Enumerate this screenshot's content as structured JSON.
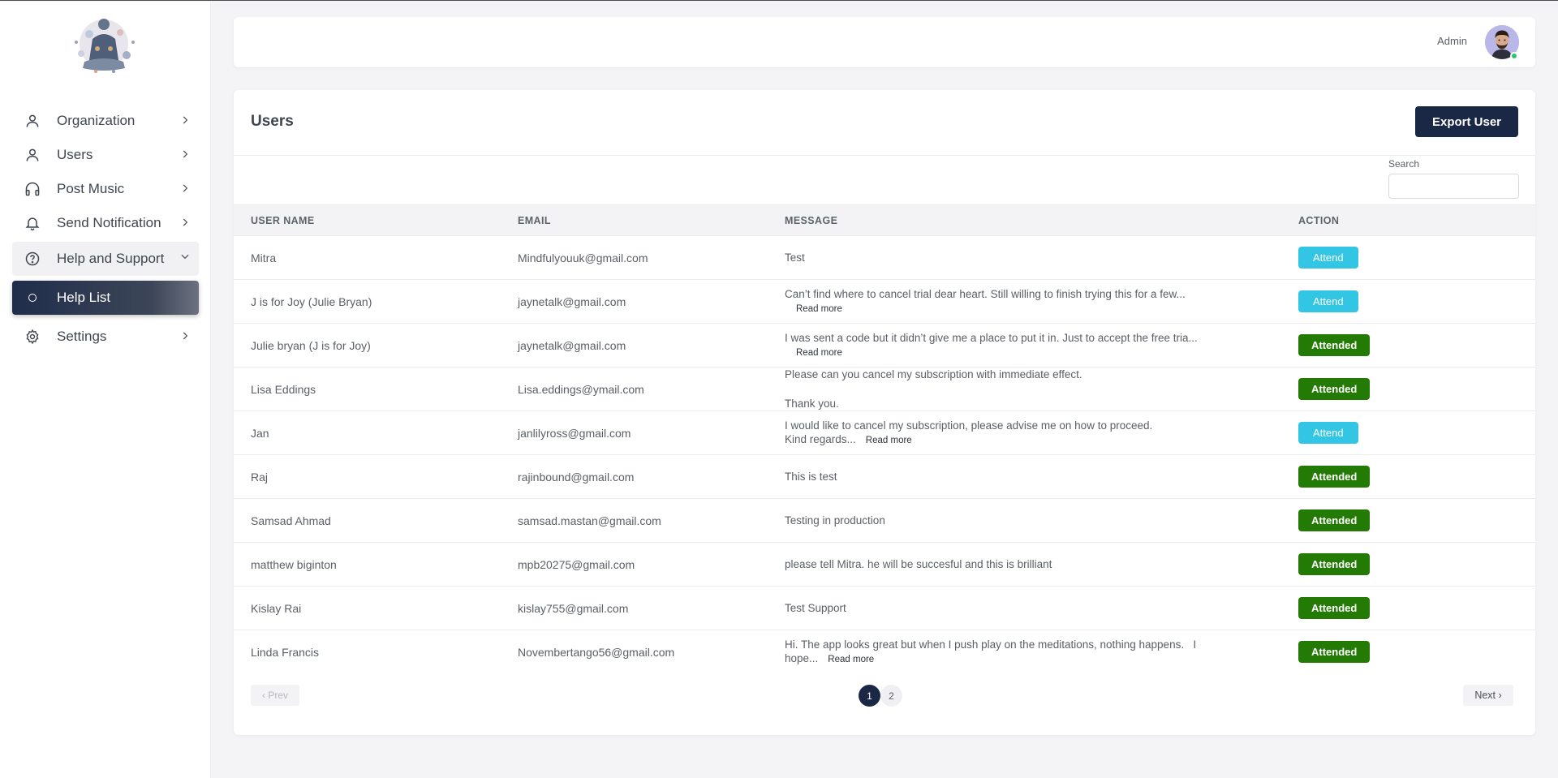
{
  "header": {
    "user_label": "Admin"
  },
  "sidebar": {
    "items": [
      {
        "label": "Organization",
        "icon": "user-icon"
      },
      {
        "label": "Users",
        "icon": "user-icon"
      },
      {
        "label": "Post Music",
        "icon": "headphones-icon"
      },
      {
        "label": "Send Notification",
        "icon": "bell-icon"
      },
      {
        "label": "Help and Support",
        "icon": "help-circle-icon"
      },
      {
        "label": "Help List",
        "icon": "circle-icon"
      },
      {
        "label": "Settings",
        "icon": "gear-icon"
      }
    ]
  },
  "main": {
    "title": "Users",
    "export_label": "Export User",
    "search_label": "Search",
    "search_value": "",
    "columns": [
      "USER NAME",
      "EMAIL",
      "MESSAGE",
      "ACTION"
    ],
    "read_more": "Read more",
    "rows": [
      {
        "name": "Mitra",
        "email": "Mindfulyouuk@gmail.com",
        "message": "Test",
        "action": "Attend"
      },
      {
        "name": "J is for Joy (Julie Bryan)",
        "email": "jaynetalk@gmail.com",
        "message": "Can’t find where to cancel trial dear heart. Still willing to finish trying this for a few...",
        "action": "Attend"
      },
      {
        "name": "Julie bryan (J is for Joy)",
        "email": "jaynetalk@gmail.com",
        "message": "I was sent a code but it didn’t give me a place to put it in. Just to accept the free tria...",
        "action": "Attended"
      },
      {
        "name": "Lisa Eddings",
        "email": "Lisa.eddings@ymail.com",
        "message": "Please can you cancel my subscription with immediate effect.",
        "message_2": "Thank you.",
        "action": "Attended"
      },
      {
        "name": "Jan",
        "email": "janlilyross@gmail.com",
        "message": "I would like to cancel my subscription, please advise me on how to proceed.",
        "message_2": "Kind regards...",
        "action": "Attend"
      },
      {
        "name": "Raj",
        "email": "rajinbound@gmail.com",
        "message": "This is test",
        "action": "Attended"
      },
      {
        "name": "Samsad Ahmad",
        "email": "samsad.mastan@gmail.com",
        "message": "Testing in production",
        "action": "Attended"
      },
      {
        "name": "matthew biginton",
        "email": "mpb20275@gmail.com",
        "message": "please tell Mitra. he will be succesful and this is brilliant",
        "action": "Attended"
      },
      {
        "name": "Kislay Rai",
        "email": "kislay755@gmail.com",
        "message": "Test Support",
        "action": "Attended"
      },
      {
        "name": "Linda Francis",
        "email": "Novembertango56@gmail.com",
        "message": "Hi. The app looks great but when I push play on the meditations, nothing happens.   I",
        "message_2": "hope...",
        "action": "Attended"
      }
    ]
  },
  "pagination": {
    "prev_label": "‹ Prev",
    "next_label": "Next ›",
    "pages": [
      "1",
      "2"
    ],
    "current_page": "1"
  },
  "colors": {
    "primary": "#1b2845",
    "attend": "#33c6e4",
    "attended": "#237a04",
    "online_status": "#28c76f"
  }
}
